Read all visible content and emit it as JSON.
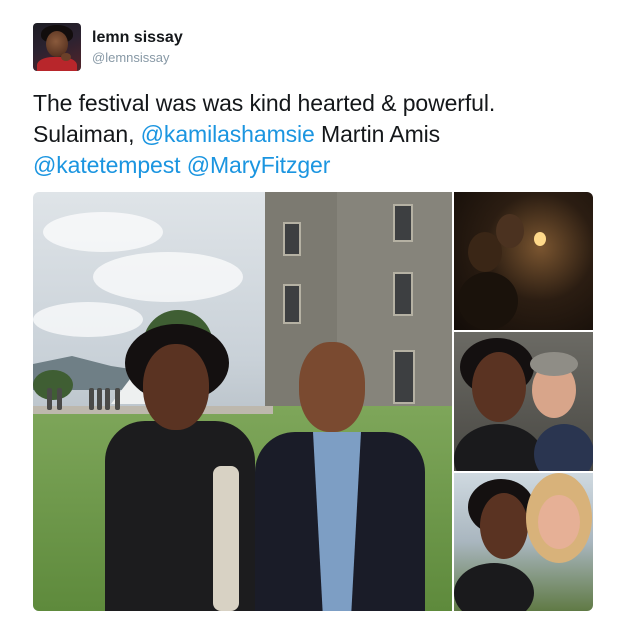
{
  "author": {
    "display_name": "lemn sissay",
    "handle": "@lemnsissay"
  },
  "tweet": {
    "line1": "The festival was was kind hearted & powerful.",
    "line2_prefix": "Sulaiman, ",
    "mention_kamila": "@kamilashamsie",
    "line2_suffix": " Martin Amis",
    "mention_kate": "@katetempest",
    "mention_mary": "@MaryFitzger"
  },
  "colors": {
    "mention": "#1b95e0",
    "text": "#14171a",
    "handle": "#8899a6"
  }
}
